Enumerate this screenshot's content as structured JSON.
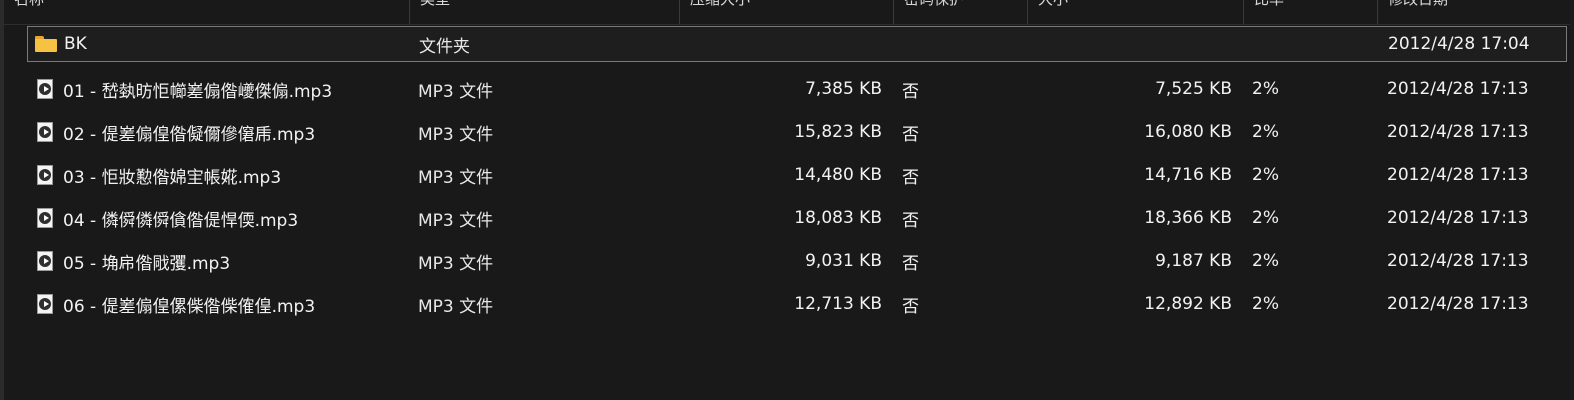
{
  "header": {
    "columns": [
      "名称",
      "类型",
      "压缩大小",
      "密码保护",
      "大小",
      "比率",
      "修改日期"
    ]
  },
  "icons": {
    "folder": "folder-icon",
    "file": "mp3-file-icon"
  },
  "files": [
    {
      "name": "BK",
      "type": "文件夹",
      "compressed": "",
      "password": "",
      "size": "",
      "ratio": "",
      "date": "2012/4/28 17:04",
      "kind": "folder",
      "selected": true
    },
    {
      "name": "01 - 嵆埶昉怇幯嵳傓偺巙傑傓.mp3",
      "type": "MP3 文件",
      "compressed": "7,385 KB",
      "password": "否",
      "size": "7,525 KB",
      "ratio": "2%",
      "date": "2012/4/28 17:13",
      "kind": "file"
    },
    {
      "name": "02 - 偍嵳傓偟偺儗儞傪僒乕.mp3",
      "type": "MP3 文件",
      "compressed": "15,823 KB",
      "password": "否",
      "size": "16,080 KB",
      "ratio": "2%",
      "date": "2012/4/28 17:13",
      "kind": "file"
    },
    {
      "name": "03 - 怇妝懃偺婂宔帳婲.mp3",
      "type": "MP3 文件",
      "compressed": "14,480 KB",
      "password": "否",
      "size": "14,716 KB",
      "ratio": "2%",
      "date": "2012/4/28 17:13",
      "kind": "file"
    },
    {
      "name": "04 - 僯僢僯僢僋偺偍悍偄.mp3",
      "type": "MP3 文件",
      "compressed": "18,083 KB",
      "password": "否",
      "size": "18,366 KB",
      "ratio": "2%",
      "date": "2012/4/28 17:13",
      "kind": "file"
    },
    {
      "name": "05 - 埆帍偺戙彏.mp3",
      "type": "MP3 文件",
      "compressed": "9,031 KB",
      "password": "否",
      "size": "9,187 KB",
      "ratio": "2%",
      "date": "2012/4/28 17:13",
      "kind": "file"
    },
    {
      "name": "06 - 偍嵳傓偟傫偨偺偨傕偟.mp3",
      "type": "MP3 文件",
      "compressed": "12,713 KB",
      "password": "否",
      "size": "12,892 KB",
      "ratio": "2%",
      "date": "2012/4/28 17:13",
      "kind": "file"
    }
  ]
}
